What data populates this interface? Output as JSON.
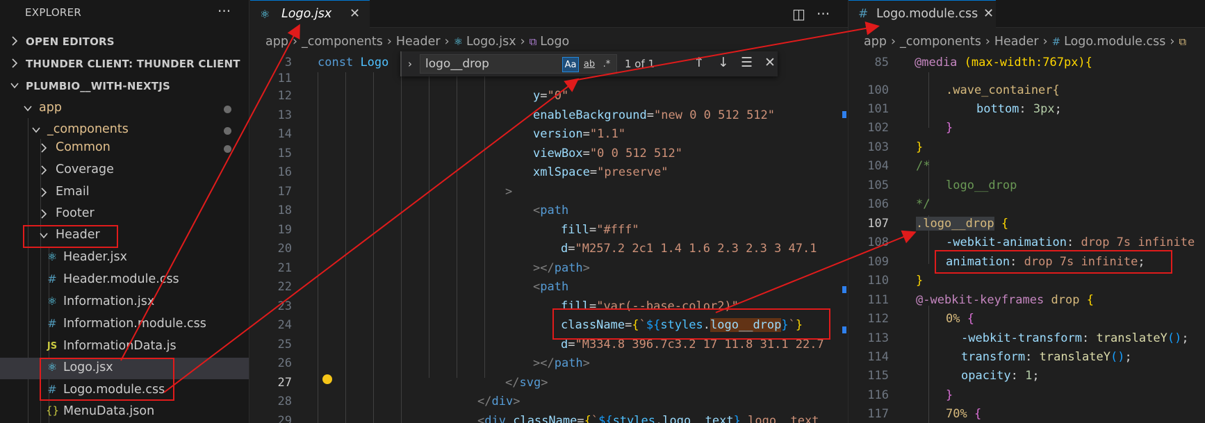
{
  "explorer": {
    "title": "EXPLORER",
    "more": "···",
    "sections": [
      "OPEN EDITORS",
      "THUNDER CLIENT: THUNDER CLIENT",
      "PLUMBIO__WITH-NEXTJS"
    ],
    "tree": [
      {
        "label": "app",
        "type": "folder",
        "modified": true
      },
      {
        "label": "_components",
        "type": "folder",
        "modified": true
      },
      {
        "label": "Common",
        "type": "folder",
        "modified": true
      },
      {
        "label": "Coverage",
        "type": "folder"
      },
      {
        "label": "Email",
        "type": "folder"
      },
      {
        "label": "Footer",
        "type": "folder"
      },
      {
        "label": "Header",
        "type": "folder"
      },
      {
        "label": "Header.jsx",
        "type": "jsx"
      },
      {
        "label": "Header.module.css",
        "type": "css"
      },
      {
        "label": "Information.jsx",
        "type": "jsx"
      },
      {
        "label": "Information.module.css",
        "type": "css"
      },
      {
        "label": "InformationData.js",
        "type": "js"
      },
      {
        "label": "Logo.jsx",
        "type": "jsx"
      },
      {
        "label": "Logo.module.css",
        "type": "css"
      },
      {
        "label": "MenuData.json",
        "type": "json"
      }
    ]
  },
  "icons": {
    "react": "react-icon",
    "css": "hash-icon",
    "js": "js-icon",
    "json": "braces-icon"
  },
  "editor1": {
    "tab": "Logo.jsx",
    "close": "✕",
    "split": "◫",
    "more": "···",
    "breadcrumb": [
      "app",
      "_components",
      "Header",
      "Logo.jsx",
      "Logo"
    ],
    "sticky": {
      "num": "3",
      "kw": "const",
      "name": "Logo"
    },
    "find": {
      "query": "logo__drop",
      "count": "1 of 1",
      "case": "Aa",
      "word": "ab",
      "regex": ".*"
    },
    "line_numbers": [
      "11",
      "12",
      "13",
      "14",
      "15",
      "16",
      "17",
      "18",
      "19",
      "20",
      "21",
      "22",
      "23",
      "24",
      "25",
      "26",
      "27",
      "28",
      "29"
    ],
    "code": {
      "l12a": "y",
      "l12b": "\"0\"",
      "l13a": "enableBackground",
      "l13b": "\"new 0 0 512 512\"",
      "l14a": "version",
      "l14b": "\"1.1\"",
      "l15a": "viewBox",
      "l15b": "\"0 0 512 512\"",
      "l16a": "xmlSpace",
      "l16b": "\"preserve\"",
      "l17": ">",
      "l18": "path",
      "l19a": "fill",
      "l19b": "\"#fff\"",
      "l20a": "d",
      "l20b": "\"M257.2 2c1 1.4 1.6 2.3 2.3 3 47.1",
      "l21": "path",
      "l22": "path",
      "l23a": "fill",
      "l23b": "\"var(--base-color2)\"",
      "l24a": "className",
      "l24b": "styles",
      "l24c": "logo__drop",
      "l25a": "d",
      "l25b": "\"M334.8 396.7c3.2 17 11.8 31.1 22.7",
      "l26": "path",
      "l27": "svg",
      "l28": "div",
      "l29a": "div",
      "l29b": "className",
      "l29c": "styles",
      "l29d": "logo__text",
      "l29e": "logo__text"
    }
  },
  "editor2": {
    "tab": "Logo.module.css",
    "close": "✕",
    "breadcrumb": [
      "app",
      "_components",
      "Header",
      "Logo.module.css"
    ],
    "sticky": {
      "num": "85",
      "at": "@media",
      "cond": "(max-width:767px){"
    },
    "line_numbers": [
      "100",
      "101",
      "102",
      "103",
      "104",
      "105",
      "106",
      "107",
      "108",
      "109",
      "110",
      "111",
      "112",
      "113",
      "114",
      "115",
      "116",
      "117"
    ],
    "code": {
      "l100": ".wave_container{",
      "l101a": "bottom",
      "l101b": "3px",
      "l102": "}",
      "l103": "}",
      "l104": "/*",
      "l105": "logo__drop",
      "l106": "*/",
      "l107a": ".logo__drop",
      "l107b": "{",
      "l108a": "-webkit-animation",
      "l108b": "drop 7s infinite",
      "l109a": "animation",
      "l109b": "drop 7s",
      "l109c": "infinite",
      "l110": "}",
      "l111a": "@-webkit-keyframes",
      "l111b": "drop",
      "l111c": "{",
      "l112a": "0%",
      "l112b": "{",
      "l113a": "-webkit-transform",
      "l113b": "translateY",
      "l114a": "transform",
      "l114b": "translateY",
      "l115a": "opacity",
      "l115b": "1",
      "l116": "}",
      "l117a": "70%",
      "l117b": "{"
    }
  },
  "colors": {
    "annotation": "#e01b1b",
    "accent": "#0078d4",
    "modified": "#e2c08d"
  }
}
